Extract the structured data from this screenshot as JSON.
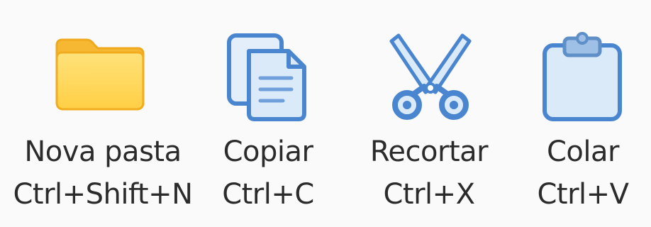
{
  "toolbar": {
    "items": [
      {
        "label": "Nova pasta",
        "shortcut": "Ctrl+Shift+N",
        "icon": "folder-icon"
      },
      {
        "label": "Copiar",
        "shortcut": "Ctrl+C",
        "icon": "copy-icon"
      },
      {
        "label": "Recortar",
        "shortcut": "Ctrl+X",
        "icon": "scissors-icon"
      },
      {
        "label": "Colar",
        "shortcut": "Ctrl+V",
        "icon": "clipboard-icon"
      }
    ]
  },
  "colors": {
    "folder_fill": "#ffd85c",
    "folder_border": "#f2ac1f",
    "icon_fill": "#dbeaf9",
    "icon_stroke": "#4a86d0",
    "text": "#2b2b2b",
    "background": "#fafafa"
  }
}
